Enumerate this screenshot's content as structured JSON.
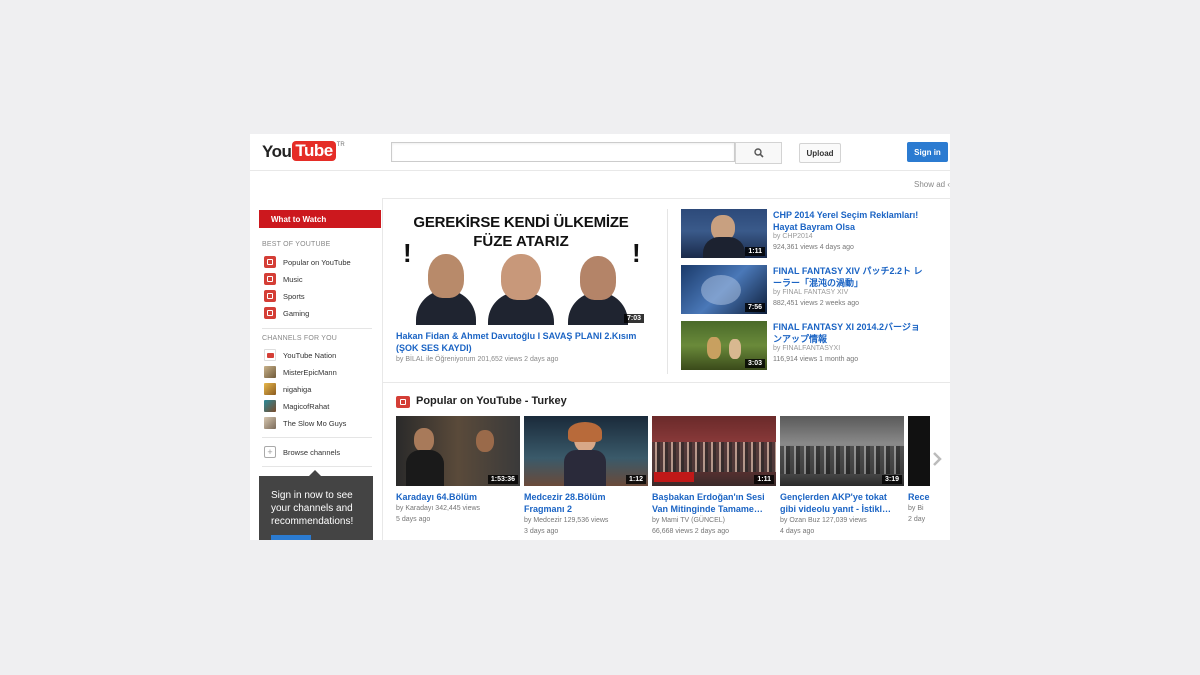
{
  "masthead": {
    "logo_you": "You",
    "logo_tube": "Tube",
    "logo_region": "TR",
    "search_placeholder": "",
    "upload_label": "Upload",
    "signin_label": "Sign in",
    "show_ad": "Show ad ‹"
  },
  "guide": {
    "header": "What to Watch",
    "best_title": "BEST OF YOUTUBE",
    "best_items": [
      "Popular on YouTube",
      "Music",
      "Sports",
      "Gaming"
    ],
    "channels_title": "CHANNELS FOR YOU",
    "channel_items": [
      "YouTube Nation",
      "MisterEpicMann",
      "nigahiga",
      "MagicofRahat",
      "The Slow Mo Guys"
    ],
    "browse_label": "Browse channels",
    "promo_text": "Sign in now to see your channels and recommendations!"
  },
  "featured": {
    "headline1": "GEREKİRSE KENDİ ÜLKEMİZE",
    "headline2": "FÜZE ATARIZ",
    "duration": "7:03",
    "title": "Hakan Fidan & Ahmet Davutoğlu I SAVAŞ PLANI 2.Kısım (ŞOK SES KAYDI)",
    "meta": "by BİLAL ile Öğreniyorum   201,652 views   2 days ago"
  },
  "side_videos": [
    {
      "title": "CHP 2014 Yerel Seçim Reklamları! Hayat Bayram Olsa",
      "by": "by CHP2014",
      "meta": "924,361 views   4 days ago",
      "duration": "1:11"
    },
    {
      "title": "FINAL FANTASY XIV パッチ2.2ト レーラー「混沌の渦動」",
      "by": "by FINAL FANTASY XIV",
      "meta": "882,451 views   2 weeks ago",
      "duration": "7:56"
    },
    {
      "title": "FINAL FANTASY XI 2014.2バージョ ンアップ情報",
      "by": "by FINALFANTASYXI",
      "meta": "116,914 views   1 month ago",
      "duration": "3:03"
    }
  ],
  "popular": {
    "title": "Popular on YouTube - Turkey",
    "items": [
      {
        "title": "Karadayı 64.Bölüm",
        "line1": "by Karadayı   342,445 views",
        "line2": "5 days ago",
        "duration": "1:53:36"
      },
      {
        "title": "Medcezir 28.Bölüm Fragmanı 2",
        "line1": "by Medcezir   129,536 views",
        "line2": "3 days ago",
        "duration": "1:12"
      },
      {
        "title": "Başbakan Erdoğan'ın Sesi Van Mitinginde Tamame…",
        "line1": "by Mami TV (GÜNCEL)",
        "line2": "66,668 views   2 days ago",
        "duration": "1:11"
      },
      {
        "title": "Gençlerden AKP'ye tokat gibi videolu yanıt - İstikl…",
        "line1": "by Ozan Buz   127,039 views",
        "line2": "4 days ago",
        "duration": "3:19"
      },
      {
        "title": "Rece",
        "line1": "by Bi",
        "line2": "2 day",
        "duration": ""
      }
    ]
  }
}
